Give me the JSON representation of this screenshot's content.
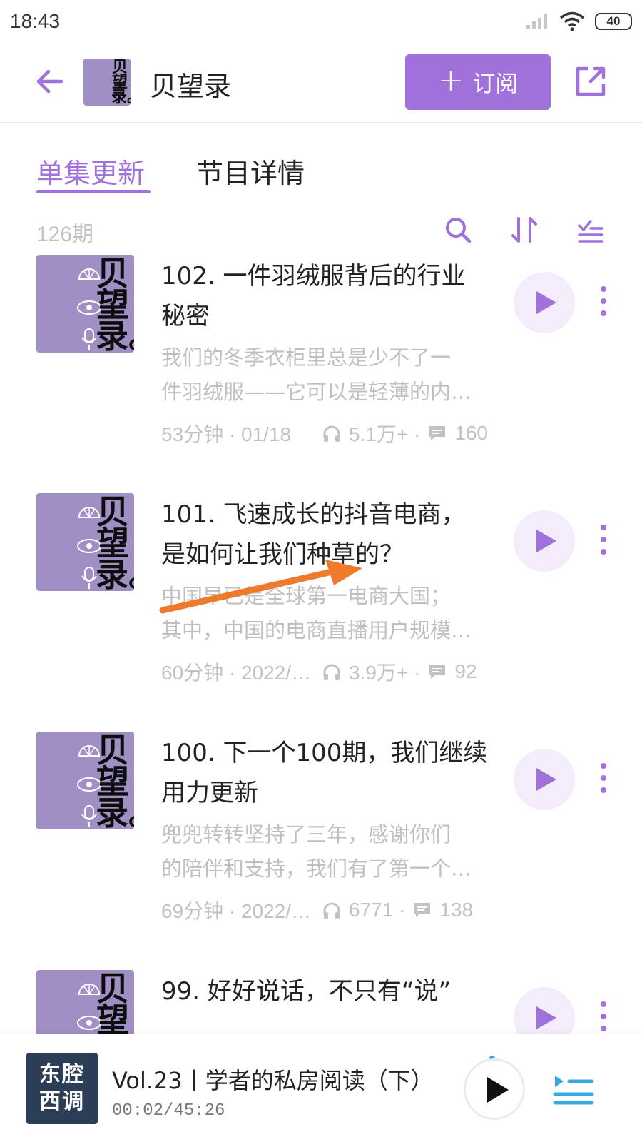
{
  "status_bar": {
    "time": "18:43",
    "battery": "40"
  },
  "header": {
    "title": "贝望录",
    "subscribe_label": "订阅"
  },
  "tabs": {
    "active": "单集更新",
    "inactive": "节目详情"
  },
  "toolbar": {
    "episode_count": "126期"
  },
  "cover_text": "贝望录。",
  "episodes": [
    {
      "title": "102. 一件羽绒服背后的行业秘密",
      "desc_line1": "我们的冬季衣柜里总是少不了一",
      "desc_line2": "件羽绒服——它可以是轻薄的内…",
      "duration_date": "53分钟 · 01/18",
      "plays": "5.1万+ ·",
      "comments": "160"
    },
    {
      "title": "101. 飞速成长的抖音电商，是如何让我们种草的？",
      "desc_line1": "中国早已是全球第一电商大国；",
      "desc_line2": "其中，中国的电商直播用户规模…",
      "duration_date": "60分钟 · 2022/…",
      "plays": "3.9万+ ·",
      "comments": "92"
    },
    {
      "title": "100. 下一个100期，我们继续用力更新",
      "desc_line1": "兜兜转转坚持了三年，感谢你们",
      "desc_line2": "的陪伴和支持，我们有了第一个…",
      "duration_date": "69分钟 · 2022/…",
      "plays": "6771 ·",
      "comments": "138"
    },
    {
      "title": "99. 好好说话，不只有“说”",
      "desc_line1": "",
      "desc_line2": "",
      "duration_date": "",
      "plays": "",
      "comments": ""
    }
  ],
  "mini_player": {
    "cover_line1": "东腔",
    "cover_line2": "西调",
    "title": "Vol.23丨学者的私房阅读（下）",
    "time": "00:02/45:26"
  },
  "colors": {
    "accent": "#a071db",
    "cover_bg": "#a08fc4",
    "muted": "#c0c0c0",
    "arrow": "#f07a2c"
  },
  "icons": [
    "back-arrow-icon",
    "share-icon",
    "search-icon",
    "sort-icon",
    "filter-list-icon",
    "play-icon",
    "more-vertical-icon",
    "headphones-icon",
    "comment-icon",
    "playlist-icon"
  ]
}
